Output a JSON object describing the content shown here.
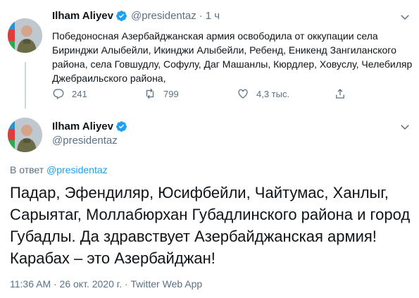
{
  "colors": {
    "accent": "#1da1f2",
    "text": "#0f1419",
    "muted": "#5b7083",
    "verified": "#1da1f2"
  },
  "tweet1": {
    "author_name": "Ilham Aliyev",
    "handle": "@presidentaz",
    "separator": "·",
    "time": "1 ч",
    "text": "Победоносная Азербайджанская армия освободила от оккупации села Биринджи Алыбейли, Икинджи Алыбейли, Ребенд, Еникенд Зангиланского района, села Говшудлу, Софулу, Даг Машанлы, Кюрдлер, Ховуслу, Челебиляр Джебраильского района,",
    "replies": "241",
    "retweets": "799",
    "likes": "4,3 тыс."
  },
  "tweet2": {
    "author_name": "Ilham Aliyev",
    "handle": "@presidentaz",
    "reply_prefix": "В ответ",
    "reply_handle": "@presidentaz",
    "text": "Падар, Эфендиляр, Юсифбейли, Чайтумас, Ханлыг, Сарыятаг, Моллабюрхан Губадлинского района и город Губадлы. Да здравствует Азербайджанская армия! Карабах – это Азербайджан!",
    "timestamp": "11:36 AM · 26 окт. 2020 г. · Twitter Web App"
  }
}
